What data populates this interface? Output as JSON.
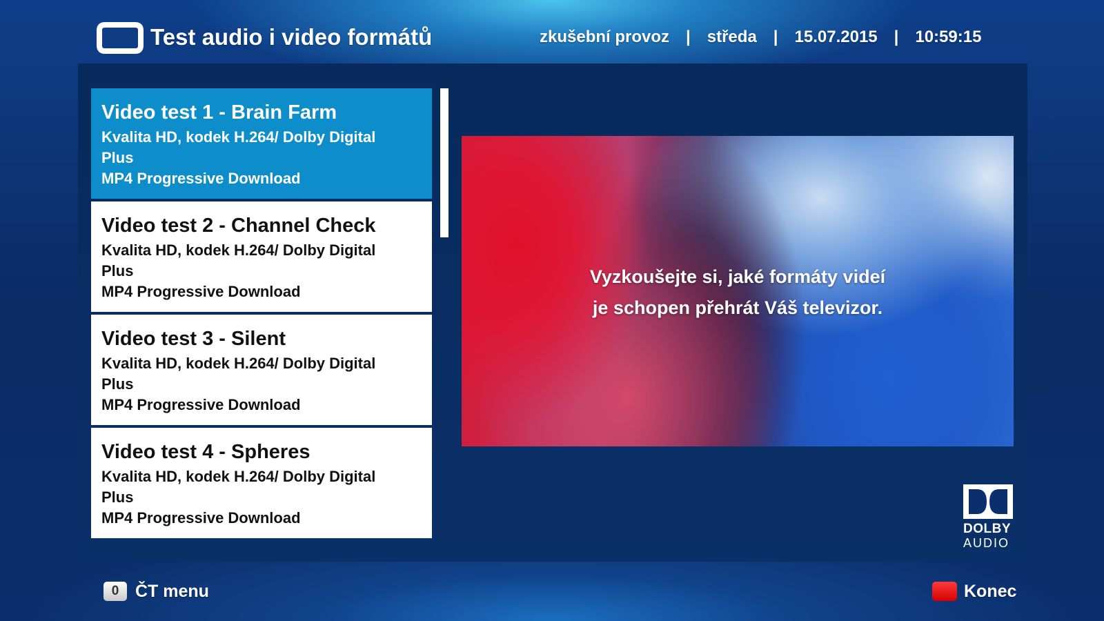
{
  "header": {
    "title": "Test audio i video formátů",
    "status": "zkušební provoz",
    "separator": "|",
    "weekday": "středa",
    "date": "15.07.2015",
    "time": "10:59:15"
  },
  "videos": [
    {
      "title": "Video test 1 - Brain Farm",
      "quality": "Kvalita HD, kodek H.264/ Dolby Digital Plus",
      "delivery": "MP4 Progressive Download",
      "selected": true
    },
    {
      "title": "Video test 2 - Channel Check",
      "quality": "Kvalita HD, kodek H.264/ Dolby Digital Plus",
      "delivery": "MP4 Progressive Download",
      "selected": false
    },
    {
      "title": "Video test 3 - Silent",
      "quality": "Kvalita HD, kodek H.264/ Dolby Digital Plus",
      "delivery": "MP4 Progressive Download",
      "selected": false
    },
    {
      "title": "Video test 4 - Spheres",
      "quality": "Kvalita HD, kodek H.264/ Dolby Digital Plus",
      "delivery": "MP4 Progressive Download",
      "selected": false
    }
  ],
  "preview": {
    "line1": "Vyzkoušejte si, jaké formáty videí",
    "line2": "je schopen přehrát Váš televizor."
  },
  "dolby": {
    "name": "DOLBY",
    "sub": "AUDIO"
  },
  "footer": {
    "menu_key": "0",
    "menu_label": "ČT menu",
    "exit_label": "Konec"
  },
  "colors": {
    "selected_item": "#0d8dc9",
    "item_background": "#ffffff",
    "exit_key": "#e00000"
  },
  "icons": {
    "logo": "ct-logo-icon",
    "dolby": "dolby-audio-icon",
    "exit_key": "red-button-icon"
  }
}
